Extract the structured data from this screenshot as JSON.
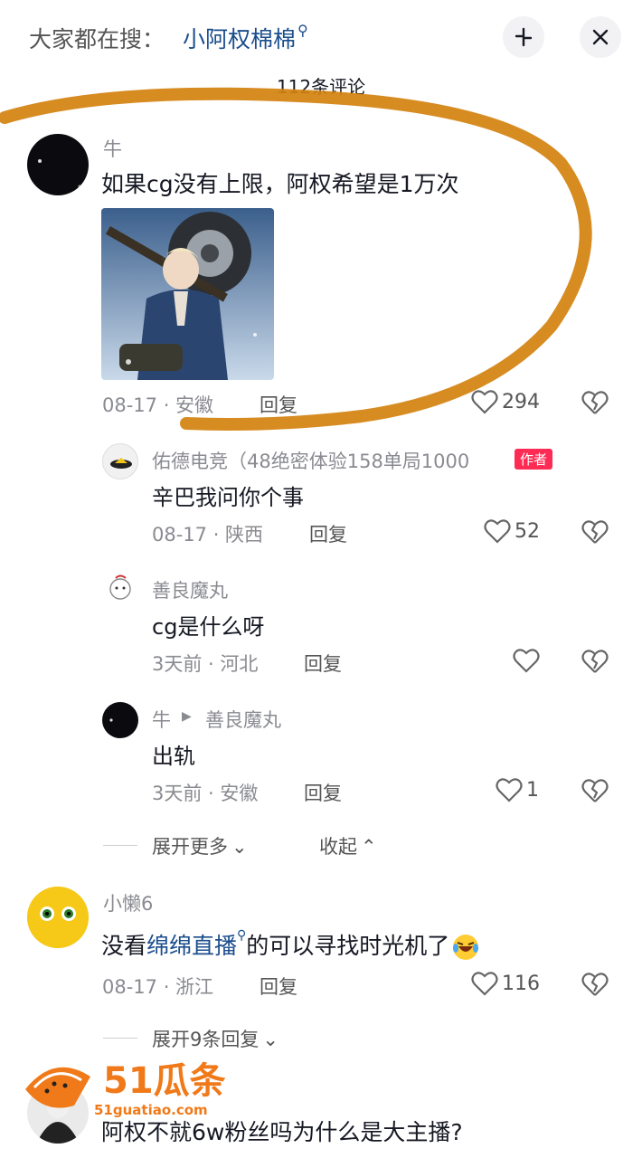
{
  "header": {
    "search_prefix": "大家都在搜：",
    "search_term": "小阿权棉棉",
    "comment_count": "112条评论"
  },
  "comments": [
    {
      "user": "牛",
      "text": "如果cg没有上限，阿权希望是1万次",
      "date": "08-17 · 安徽",
      "reply": "回复",
      "likes": "294"
    },
    {
      "user": "佑德电竞（48绝密体验158单局1000",
      "badge": "作者",
      "text": "辛巴我问你个事",
      "date": "08-17 · 陕西",
      "reply": "回复",
      "likes": "52"
    },
    {
      "user": "善良魔丸",
      "text": "cg是什么呀",
      "date": "3天前 · 河北",
      "reply": "回复",
      "likes": ""
    },
    {
      "user": "牛",
      "reply_to": "善良魔丸",
      "text": "出轨",
      "date": "3天前 · 安徽",
      "reply": "回复",
      "likes": "1"
    },
    {
      "user": "小懒6",
      "text_before": "没看",
      "text_link": "绵绵直播",
      "text_after": "的可以寻找时光机了",
      "date": "08-17 · 浙江",
      "reply": "回复",
      "likes": "116"
    },
    {
      "text": "阿权不就6w粉丝吗为什么是大主播?"
    }
  ],
  "thread": {
    "expand_more": "展开更多",
    "collapse": "收起",
    "expand_9": "展开9条回复"
  },
  "watermark": {
    "brand": "51瓜条",
    "url": "51guatiao.com"
  },
  "colors": {
    "annotation": "#d4820f",
    "link": "#1a4d8c",
    "badge": "#fe2c55"
  }
}
